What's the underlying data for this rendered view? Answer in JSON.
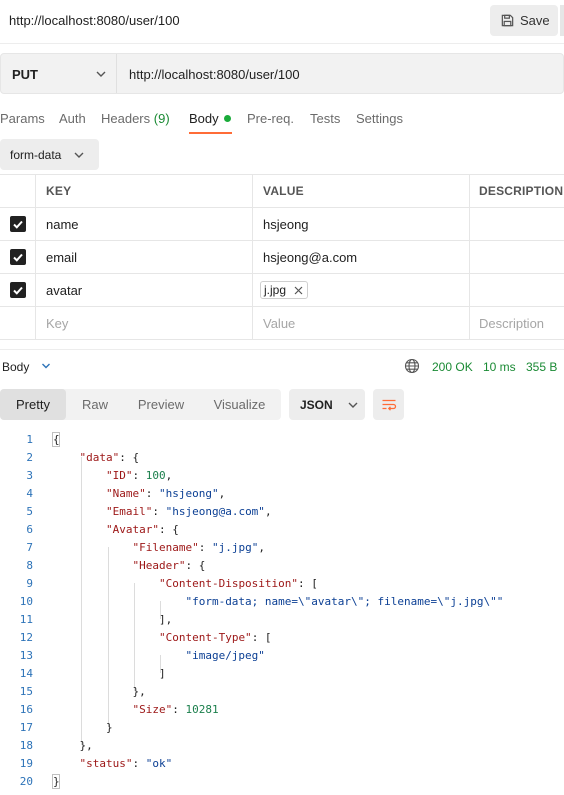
{
  "window": {
    "title": "http://localhost:8080/user/100",
    "save_label": "Save"
  },
  "request": {
    "method": "PUT",
    "url": "http://localhost:8080/user/100"
  },
  "tabs": [
    {
      "label": "Params"
    },
    {
      "label": "Auth"
    },
    {
      "label": "Headers",
      "count": "(9)"
    },
    {
      "label": "Body",
      "active": true
    },
    {
      "label": "Pre-req."
    },
    {
      "label": "Tests"
    },
    {
      "label": "Settings"
    }
  ],
  "body_mode": "form-data",
  "form_table": {
    "headers": [
      "KEY",
      "VALUE",
      "DESCRIPTION"
    ],
    "rows": [
      {
        "checked": true,
        "key": "name",
        "value": "hsjeong",
        "description": ""
      },
      {
        "checked": true,
        "key": "email",
        "value": "hsjeong@a.com",
        "description": ""
      },
      {
        "checked": true,
        "key": "avatar",
        "file": "j.jpg",
        "description": ""
      }
    ],
    "placeholders": {
      "key": "Key",
      "value": "Value",
      "description": "Description"
    }
  },
  "response": {
    "section_label": "Body",
    "status": "200 OK",
    "time": "10 ms",
    "size": "355 B",
    "view_tabs": [
      "Pretty",
      "Raw",
      "Preview",
      "Visualize"
    ],
    "active_view": "Pretty",
    "format": "JSON"
  },
  "icons": {
    "save": "floppy-disk-icon",
    "dropdown": "chevron-down-icon",
    "globe": "globe-icon",
    "wrap": "wrap-lines-icon",
    "remove": "close-icon"
  },
  "colors": {
    "accent": "#ff6c37",
    "success": "#1a8a34",
    "json_key": "#9c1616",
    "json_string": "#0b3f94",
    "json_number": "#1b7f4c"
  },
  "code_lines": [
    {
      "n": "1",
      "text": "{"
    },
    {
      "n": "2",
      "text": "    \"data\": {"
    },
    {
      "n": "3",
      "text": "        \"ID\": 100,"
    },
    {
      "n": "4",
      "text": "        \"Name\": \"hsjeong\","
    },
    {
      "n": "5",
      "text": "        \"Email\": \"hsjeong@a.com\","
    },
    {
      "n": "6",
      "text": "        \"Avatar\": {"
    },
    {
      "n": "7",
      "text": "            \"Filename\": \"j.jpg\","
    },
    {
      "n": "8",
      "text": "            \"Header\": {"
    },
    {
      "n": "9",
      "text": "                \"Content-Disposition\": ["
    },
    {
      "n": "10",
      "text": "                    \"form-data; name=\\\"avatar\\\"; filename=\\\"j.jpg\\\"\""
    },
    {
      "n": "11",
      "text": "                ],"
    },
    {
      "n": "12",
      "text": "                \"Content-Type\": ["
    },
    {
      "n": "13",
      "text": "                    \"image/jpeg\""
    },
    {
      "n": "14",
      "text": "                ]"
    },
    {
      "n": "15",
      "text": "            },"
    },
    {
      "n": "16",
      "text": "            \"Size\": 10281"
    },
    {
      "n": "17",
      "text": "        }"
    },
    {
      "n": "18",
      "text": "    },"
    },
    {
      "n": "19",
      "text": "    \"status\": \"ok\""
    },
    {
      "n": "20",
      "text": "}"
    }
  ]
}
